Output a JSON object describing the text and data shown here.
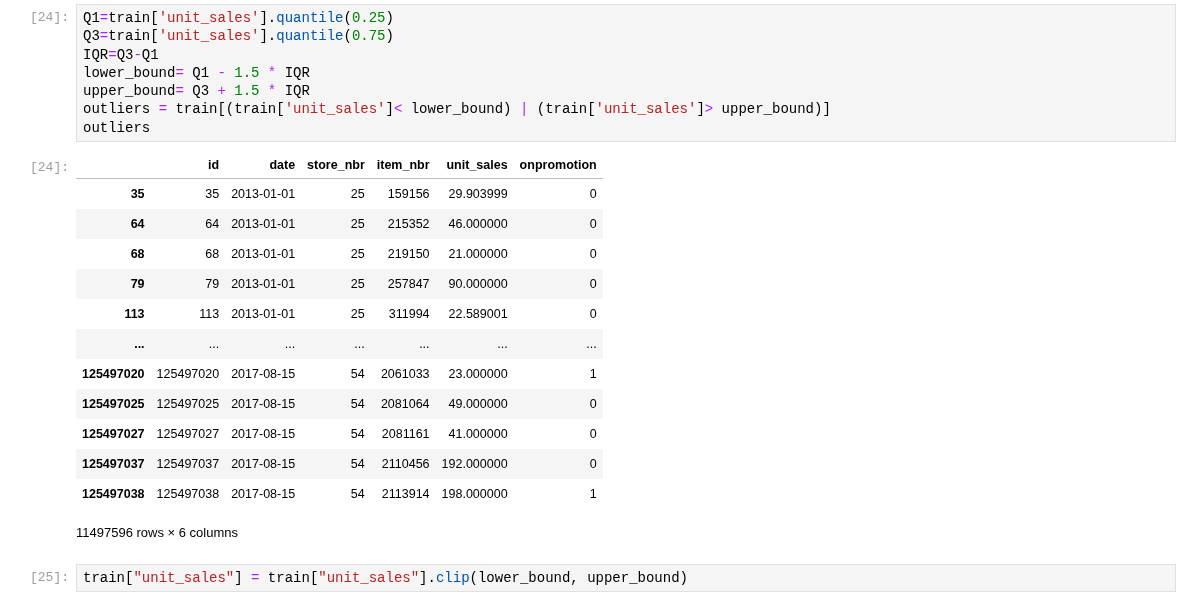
{
  "cells": [
    {
      "kind": "code",
      "prompt": "[24]:",
      "lines": [
        [
          {
            "kind": "plain",
            "text": "Q1"
          },
          {
            "kind": "op",
            "text": "="
          },
          {
            "kind": "plain",
            "text": "train["
          },
          {
            "kind": "str",
            "text": "'unit_sales'"
          },
          {
            "kind": "plain",
            "text": "]."
          },
          {
            "kind": "attr",
            "text": "quantile"
          },
          {
            "kind": "plain",
            "text": "("
          },
          {
            "kind": "num",
            "text": "0.25"
          },
          {
            "kind": "plain",
            "text": ")"
          }
        ],
        [
          {
            "kind": "plain",
            "text": "Q3"
          },
          {
            "kind": "op",
            "text": "="
          },
          {
            "kind": "plain",
            "text": "train["
          },
          {
            "kind": "str",
            "text": "'unit_sales'"
          },
          {
            "kind": "plain",
            "text": "]."
          },
          {
            "kind": "attr",
            "text": "quantile"
          },
          {
            "kind": "plain",
            "text": "("
          },
          {
            "kind": "num",
            "text": "0.75"
          },
          {
            "kind": "plain",
            "text": ")"
          }
        ],
        [
          {
            "kind": "plain",
            "text": "IQR"
          },
          {
            "kind": "op",
            "text": "="
          },
          {
            "kind": "plain",
            "text": "Q3"
          },
          {
            "kind": "op",
            "text": "-"
          },
          {
            "kind": "plain",
            "text": "Q1"
          }
        ],
        [
          {
            "kind": "plain",
            "text": "lower_bound"
          },
          {
            "kind": "op",
            "text": "="
          },
          {
            "kind": "plain",
            "text": " Q1 "
          },
          {
            "kind": "op",
            "text": "-"
          },
          {
            "kind": "num",
            "text": " 1.5"
          },
          {
            "kind": "op",
            "text": " * "
          },
          {
            "kind": "plain",
            "text": "IQR"
          }
        ],
        [
          {
            "kind": "plain",
            "text": "upper_bound"
          },
          {
            "kind": "op",
            "text": "="
          },
          {
            "kind": "plain",
            "text": " Q3 "
          },
          {
            "kind": "op",
            "text": "+"
          },
          {
            "kind": "num",
            "text": " 1.5"
          },
          {
            "kind": "op",
            "text": " * "
          },
          {
            "kind": "plain",
            "text": "IQR"
          }
        ],
        [
          {
            "kind": "plain",
            "text": "outliers "
          },
          {
            "kind": "op",
            "text": "="
          },
          {
            "kind": "plain",
            "text": " train[(train["
          },
          {
            "kind": "str",
            "text": "'unit_sales'"
          },
          {
            "kind": "plain",
            "text": "]"
          },
          {
            "kind": "op",
            "text": "<"
          },
          {
            "kind": "plain",
            "text": " lower_bound) "
          },
          {
            "kind": "op",
            "text": "|"
          },
          {
            "kind": "plain",
            "text": " (train["
          },
          {
            "kind": "str",
            "text": "'unit_sales'"
          },
          {
            "kind": "plain",
            "text": "]"
          },
          {
            "kind": "op",
            "text": ">"
          },
          {
            "kind": "plain",
            "text": " upper_bound)]"
          }
        ],
        [
          {
            "kind": "plain",
            "text": "outliers"
          }
        ]
      ]
    },
    {
      "kind": "table",
      "prompt": "[24]:",
      "columns": [
        "id",
        "date",
        "store_nbr",
        "item_nbr",
        "unit_sales",
        "onpromotion"
      ],
      "rows": [
        {
          "index": "35",
          "cells": [
            "35",
            "2013-01-01",
            "25",
            "159156",
            "29.903999",
            "0"
          ]
        },
        {
          "index": "64",
          "cells": [
            "64",
            "2013-01-01",
            "25",
            "215352",
            "46.000000",
            "0"
          ]
        },
        {
          "index": "68",
          "cells": [
            "68",
            "2013-01-01",
            "25",
            "219150",
            "21.000000",
            "0"
          ]
        },
        {
          "index": "79",
          "cells": [
            "79",
            "2013-01-01",
            "25",
            "257847",
            "90.000000",
            "0"
          ]
        },
        {
          "index": "113",
          "cells": [
            "113",
            "2013-01-01",
            "25",
            "311994",
            "22.589001",
            "0"
          ]
        },
        {
          "index": "...",
          "cells": [
            "...",
            "...",
            "...",
            "...",
            "...",
            "..."
          ]
        },
        {
          "index": "125497020",
          "cells": [
            "125497020",
            "2017-08-15",
            "54",
            "2061033",
            "23.000000",
            "1"
          ]
        },
        {
          "index": "125497025",
          "cells": [
            "125497025",
            "2017-08-15",
            "54",
            "2081064",
            "49.000000",
            "0"
          ]
        },
        {
          "index": "125497027",
          "cells": [
            "125497027",
            "2017-08-15",
            "54",
            "2081161",
            "41.000000",
            "0"
          ]
        },
        {
          "index": "125497037",
          "cells": [
            "125497037",
            "2017-08-15",
            "54",
            "2110456",
            "192.000000",
            "0"
          ]
        },
        {
          "index": "125497038",
          "cells": [
            "125497038",
            "2017-08-15",
            "54",
            "2113914",
            "198.000000",
            "1"
          ]
        }
      ],
      "summary": "11497596 rows × 6 columns"
    },
    {
      "kind": "code",
      "prompt": "[25]:",
      "lines": [
        [
          {
            "kind": "plain",
            "text": "train["
          },
          {
            "kind": "str",
            "text": "\"unit_sales\""
          },
          {
            "kind": "plain",
            "text": "] "
          },
          {
            "kind": "op",
            "text": "="
          },
          {
            "kind": "plain",
            "text": " train["
          },
          {
            "kind": "str",
            "text": "\"unit_sales\""
          },
          {
            "kind": "plain",
            "text": "]."
          },
          {
            "kind": "attr",
            "text": "clip"
          },
          {
            "kind": "plain",
            "text": "(lower_bound, upper_bound)"
          }
        ]
      ]
    }
  ]
}
